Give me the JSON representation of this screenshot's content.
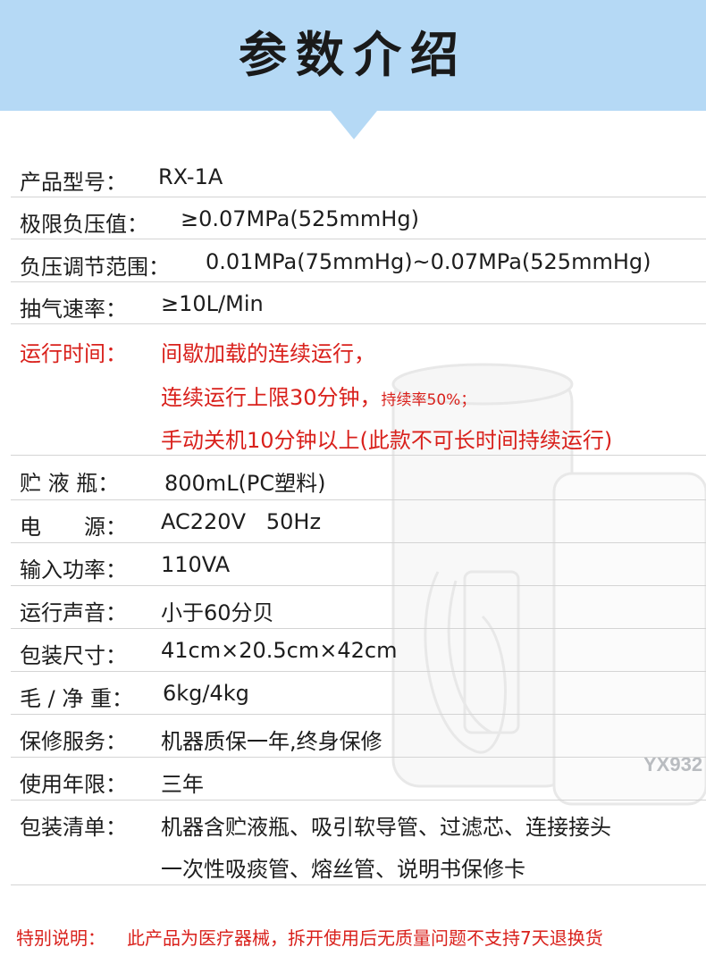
{
  "header": {
    "title": "参数介绍"
  },
  "specs": [
    {
      "label": "产品型号：",
      "value": "RX-1A"
    },
    {
      "label": "极限负压值：",
      "value": "≥0.07MPa(525mmHg)"
    },
    {
      "label": "负压调节范围：",
      "value": "0.01MPa(75mmHg)~0.07MPa(525mmHg)"
    },
    {
      "label": "抽气速率：",
      "value": "≥10L/Min"
    },
    {
      "label": "运行时间：",
      "line1": "间歇加载的连续运行，",
      "line2_main": "连续运行上限30分钟，",
      "line2_small": "持续率50%；",
      "line3": "手动关机10分钟以上(此款不可长时间持续运行)"
    },
    {
      "label": "贮 液 瓶：",
      "value": "800mL(PC塑料)"
    },
    {
      "label": "电　　源：",
      "value": "AC220V   50Hz"
    },
    {
      "label": "输入功率：",
      "value": "110VA"
    },
    {
      "label": "运行声音：",
      "value": "小于60分贝"
    },
    {
      "label": "包装尺寸：",
      "value": "41cm×20.5cm×42cm"
    },
    {
      "label": "毛 / 净 重：",
      "value": "6kg/4kg"
    },
    {
      "label": "保修服务：",
      "value": "机器质保一年,终身保修"
    },
    {
      "label": "使用年限：",
      "value": "三年"
    },
    {
      "label": "包装清单：",
      "line1": "机器含贮液瓶、吸引软导管、过滤芯、连接接头",
      "line2": "一次性吸痰管、熔丝管、说明书保修卡"
    }
  ],
  "product_image": {
    "model_text": "YX932"
  },
  "footer": {
    "label": "特别说明：",
    "text": "此产品为医疗器械，拆开使用后无质量问题不支持7天退换货"
  },
  "colors": {
    "header_bg": "#b5d9f5",
    "accent_red": "#d9211c",
    "divider": "#d4d4d4"
  }
}
